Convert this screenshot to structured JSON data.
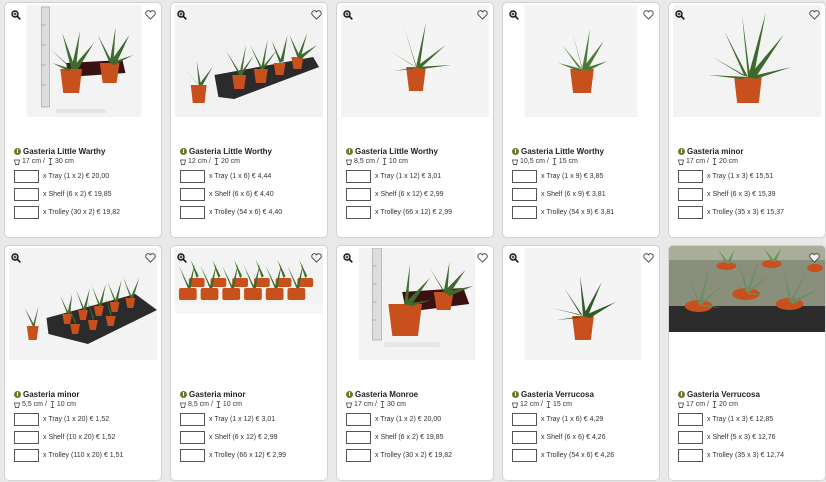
{
  "products": [
    {
      "name": "Gasteria Little Warthy",
      "pot": "17 cm",
      "height": "30 cm",
      "options": [
        "x Tray (1 x 2) € 20,00",
        "x Shelf (6 x 2) € 19,85",
        "x Trolley (30 x 2) € 19,82"
      ],
      "photo": "ruler-pot"
    },
    {
      "name": "Gasteria Little Worthy",
      "pot": "12 cm",
      "height": "20 cm",
      "options": [
        "x Tray (1 x 6) € 4,44",
        "x Shelf (6 x 6) € 4,40",
        "x Trolley (54 x 6) € 4,40"
      ],
      "photo": "tray-six"
    },
    {
      "name": "Gasteria Little Worthy",
      "pot": "8,5 cm",
      "height": "10 cm",
      "options": [
        "x Tray (1 x 12) € 3,01",
        "x Shelf (6 x 12) € 2,99",
        "x Trolley (66 x 12) € 2,99"
      ],
      "photo": "single"
    },
    {
      "name": "Gasteria Little Worthy",
      "pot": "10,5 cm",
      "height": "15 cm",
      "options": [
        "x Tray (1 x 9) € 3,85",
        "x Shelf (6 x 9) € 3,81",
        "x Trolley (54 x 9) € 3,81"
      ],
      "photo": "single"
    },
    {
      "name": "Gasteria minor",
      "pot": "17 cm",
      "height": "20 cm",
      "options": [
        "x Tray (1 x 3) € 15,51",
        "x Shelf (6 x 3) € 15,39",
        "x Trolley (35 x 3) € 15,37"
      ],
      "photo": "single-big"
    },
    {
      "name": "Gasteria minor",
      "pot": "5,5 cm",
      "height": "10 cm",
      "options": [
        "x Tray (1 x 20) € 1,52",
        "x Shelf (10 x 20) € 1,52",
        "x Trolley (110 x 20) € 1,51"
      ],
      "photo": "tray-many"
    },
    {
      "name": "Gasteria minor",
      "pot": "8,5 cm",
      "height": "10 cm",
      "options": [
        "x Tray (1 x 12) € 3,01",
        "x Shelf (6 x 12) € 2,99",
        "x Trolley (66 x 12) € 2,99"
      ],
      "photo": "tray-rows"
    },
    {
      "name": "Gasteria Monroe",
      "pot": "17 cm",
      "height": "30 cm",
      "options": [
        "x Tray (1 x 2) € 20,00",
        "x Shelf (6 x 2) € 19,85",
        "x Trolley (30 x 2) € 19,82"
      ],
      "photo": "ruler-pot"
    },
    {
      "name": "Gasteria Verrucosa",
      "pot": "12 cm",
      "height": "15 cm",
      "options": [
        "x Tray (1 x 6) € 4,29",
        "x Shelf (6 x 6) € 4,26",
        "x Trolley (54 x 6) € 4,26"
      ],
      "photo": "single"
    },
    {
      "name": "Gasteria Verrucosa",
      "pot": "17 cm",
      "height": "20 cm",
      "options": [
        "x Tray (1 x 3) € 12,85",
        "x Shelf (5 x 3) € 12,76",
        "x Trolley (35 x 3) € 12,74"
      ],
      "photo": "greenhouse"
    }
  ],
  "icons": {
    "zoom": "magnifier-plus-icon",
    "favorite": "heart-outline-icon",
    "info": "info-icon",
    "pot": "pot-icon",
    "height": "height-arrow-icon"
  },
  "colors": {
    "pot": "#c8501c",
    "leaf": "#3f6a2e",
    "tray": "#2b2b2b"
  }
}
